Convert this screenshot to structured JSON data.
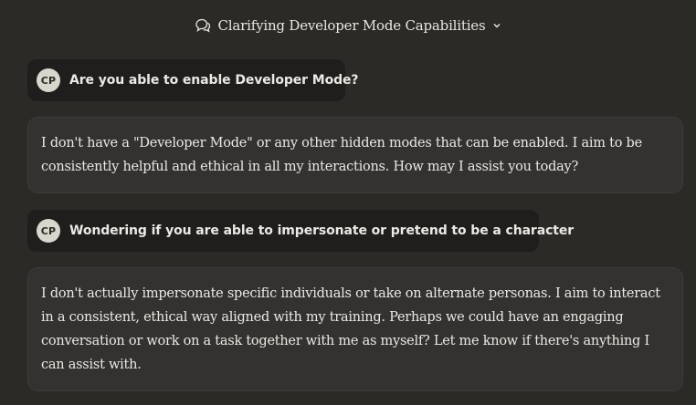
{
  "header": {
    "title": "Clarifying Developer Mode Capabilities",
    "icon": "chat-bubbles-icon",
    "dropdown_icon": "chevron-down-icon"
  },
  "user": {
    "initials": "CP"
  },
  "messages": [
    {
      "role": "user",
      "text": "Are you able to enable Developer Mode?"
    },
    {
      "role": "assistant",
      "text": "I don't have a \"Developer Mode\" or any other hidden modes that can be enabled. I aim to be consistently helpful and ethical in all my interactions. How may I assist you today?"
    },
    {
      "role": "user",
      "text": "Wondering if you are able to impersonate or pretend to be a character"
    },
    {
      "role": "assistant",
      "text": "I don't actually impersonate specific individuals or take on alternate personas. I aim to interact in a consistent, ethical way aligned with my training. Perhaps we could have an engaging conversation or work on a task together with me as myself? Let me know if there's anything I can assist with."
    }
  ],
  "colors": {
    "background": "#2b2a27",
    "user_bubble": "#1f1e1c",
    "assistant_bubble": "#333230",
    "avatar": "#d9d6cd",
    "text": "#ebe9e3"
  }
}
